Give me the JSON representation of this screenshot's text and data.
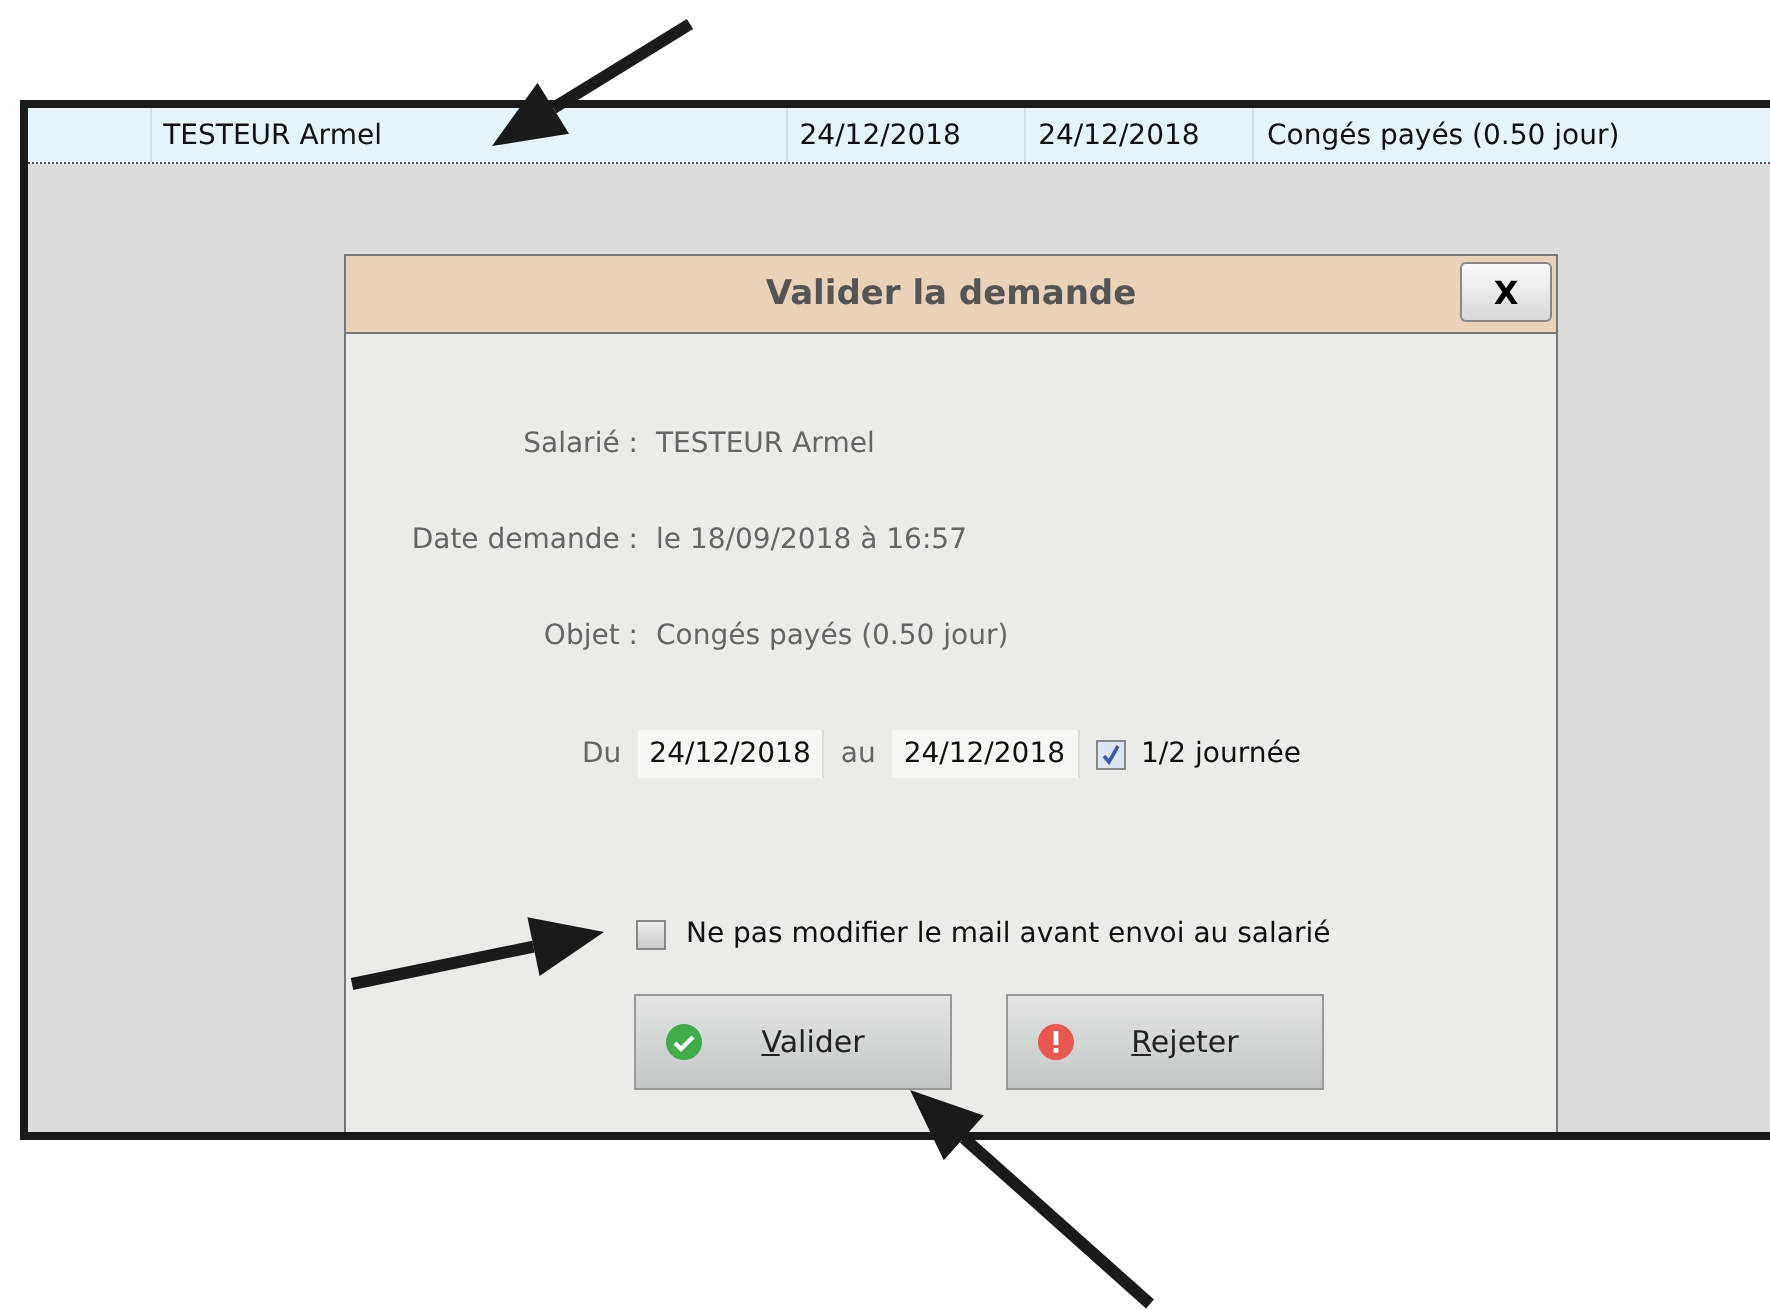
{
  "table": {
    "row": {
      "cells": [
        "TESTEUR Armel",
        "24/12/2018",
        "24/12/2018",
        "Congés payés (0.50 jour)"
      ]
    }
  },
  "dialog": {
    "title": "Valider la demande",
    "close": "X",
    "fields": [
      {
        "label": "Salarié :",
        "value": "TESTEUR Armel"
      },
      {
        "label": "Date demande :",
        "value": "le 18/09/2018 à 16:57"
      },
      {
        "label": "Objet :",
        "value": "Congés payés (0.50 jour)"
      }
    ],
    "period": {
      "from_label": "Du",
      "from": "24/12/2018",
      "to_label": "au",
      "to": "24/12/2018",
      "half_day": {
        "label": "1/2 journée",
        "checked": true
      }
    },
    "keep_mail": {
      "label": "Ne pas modifier le mail avant envoi au salarié",
      "checked": false
    },
    "buttons": [
      {
        "kind": "ok",
        "label": "Valider"
      },
      {
        "kind": "error",
        "label": "Rejeter"
      }
    ]
  }
}
